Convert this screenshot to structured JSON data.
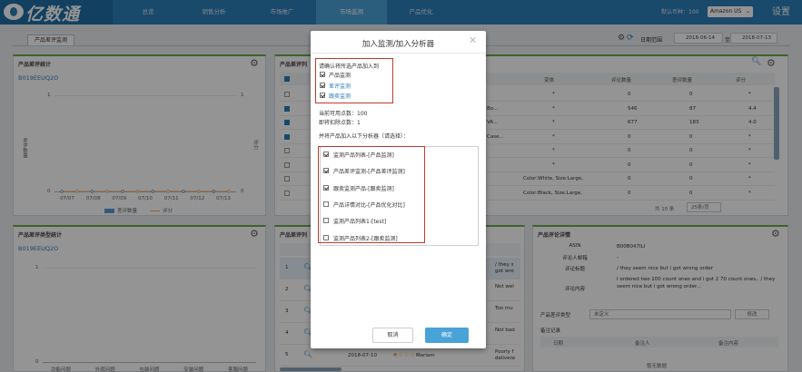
{
  "brand": {
    "name": "亿数通"
  },
  "nav": {
    "items": [
      "总览",
      "销售分析",
      "市场推广",
      "市场监测",
      "产品优化"
    ],
    "active_index": 3,
    "currency_label": "默认币种：",
    "currency_value": "100",
    "store": "Amazon US",
    "settings": "设置"
  },
  "subheader": {
    "tab": "产品差评监测",
    "date_range_label": "日期范围",
    "date_start": "2018-06-14",
    "date_end": "2018-07-13",
    "date_sep": "至"
  },
  "panel_bad_review_stats": {
    "title": "产品差评统计",
    "asin": "B019EEUQ2O",
    "y_left": [
      "1",
      "0"
    ],
    "y_right": [
      "1",
      "0"
    ],
    "y_left_label": "差评数量",
    "y_right_label": "评分",
    "x_ticks": [
      "07/07",
      "07/08",
      "07/09",
      "07/10",
      "07/11",
      "07/12",
      "07/13"
    ],
    "legend": [
      "差评数量",
      "评分"
    ]
  },
  "panel_type_stats": {
    "title": "产品差评类型统计",
    "asin": "B019EEUQ2O",
    "y_ticks": [
      "1",
      "0"
    ],
    "x_ticks": [
      "功能问题",
      "外观问题",
      "包装问题",
      "安装问题",
      "客服问题"
    ]
  },
  "panel_list": {
    "title": "产品差评列",
    "columns": [
      "变体",
      "评论数量",
      "差评数量",
      "评分"
    ],
    "rows": [
      {
        "variant": "*",
        "count": "0",
        "bad": "0",
        "score": "*",
        "desc": ""
      },
      {
        "variant": "*",
        "count": "546",
        "bad": "87",
        "score": "4.4",
        "desc": "Bo..."
      },
      {
        "variant": "*",
        "count": "677",
        "bad": "183",
        "score": "4.0",
        "desc": "VA..."
      },
      {
        "variant": "*",
        "count": "0",
        "bad": "0",
        "score": "*",
        "desc": "Case..."
      },
      {
        "variant": "*",
        "count": "0",
        "bad": "0",
        "score": "*",
        "desc": ""
      },
      {
        "variant": "*",
        "count": "0",
        "bad": "0",
        "score": "*",
        "desc": ""
      },
      {
        "variant": "Color:White, Size:Large,",
        "count": "0",
        "bad": "0",
        "score": "*",
        "desc": ""
      },
      {
        "variant": "Color:Black, Size:Large,",
        "count": "0",
        "bad": "0",
        "score": "*",
        "desc": ""
      }
    ],
    "checked": [
      false,
      true,
      true,
      true,
      false,
      false,
      false,
      false
    ],
    "total": "共 10 条",
    "page_size": "25条/页"
  },
  "panel_bottom_list": {
    "title": "产品差评列",
    "rows": [
      {
        "idx": "1",
        "text": "/ they s got wro"
      },
      {
        "idx": "2",
        "text": "Not wel"
      },
      {
        "idx": "3",
        "text": "Too mu"
      },
      {
        "idx": "4",
        "text": "Not bad"
      },
      {
        "idx": "5",
        "date": "2018-07-10",
        "user": "Mariam",
        "text": "Poorly f delivere"
      }
    ]
  },
  "panel_detail": {
    "title": "产品评论详情",
    "fields": [
      {
        "label": "ASIN",
        "value": "B00B047ILI"
      },
      {
        "label": "评论人邮箱",
        "value": "-"
      },
      {
        "label": "评论标题",
        "value": "/ they seem nice but i got wrong order"
      },
      {
        "label": "评论内容",
        "value": "I ordered two 100 count ones and i got 2 70 count ones.. / they seem nice but i got wrong order..."
      }
    ],
    "type_label": "产品差评类型",
    "type_value": "未定义",
    "type_button": "修改",
    "log_title": "备注记录",
    "log_columns": [
      "日期",
      "备注人",
      "备注内容"
    ],
    "log_empty": "暂无数据"
  },
  "modal": {
    "title": "加入监测/加入分析器",
    "confirm_label": "请确认将所选产品加入到",
    "options": [
      {
        "label": "产品监测",
        "checked": true
      },
      {
        "label": "差评监测",
        "checked": true
      },
      {
        "label": "跟卖监测",
        "checked": true
      }
    ],
    "available_label": "当前可用点数：",
    "available_value": "100",
    "deduct_label": "即将扣除点数：",
    "deduct_value": "1",
    "analyzer_label": "并将产品加入以下分析器（请选择）：",
    "analyzers": [
      {
        "label": "监测产品列表-[产品监测]",
        "checked": true
      },
      {
        "label": "产品差评监测-[产品差评监测]",
        "checked": true
      },
      {
        "label": "跟卖监测产品-[跟卖监测]",
        "checked": true
      },
      {
        "label": "产品详情对比-[产品优化对比]",
        "checked": false
      },
      {
        "label": "监测产品列表1-[test]",
        "checked": false
      },
      {
        "label": "监测产品列表2-[跟卖监测]",
        "checked": false
      }
    ],
    "cancel": "取消",
    "ok": "确定"
  }
}
